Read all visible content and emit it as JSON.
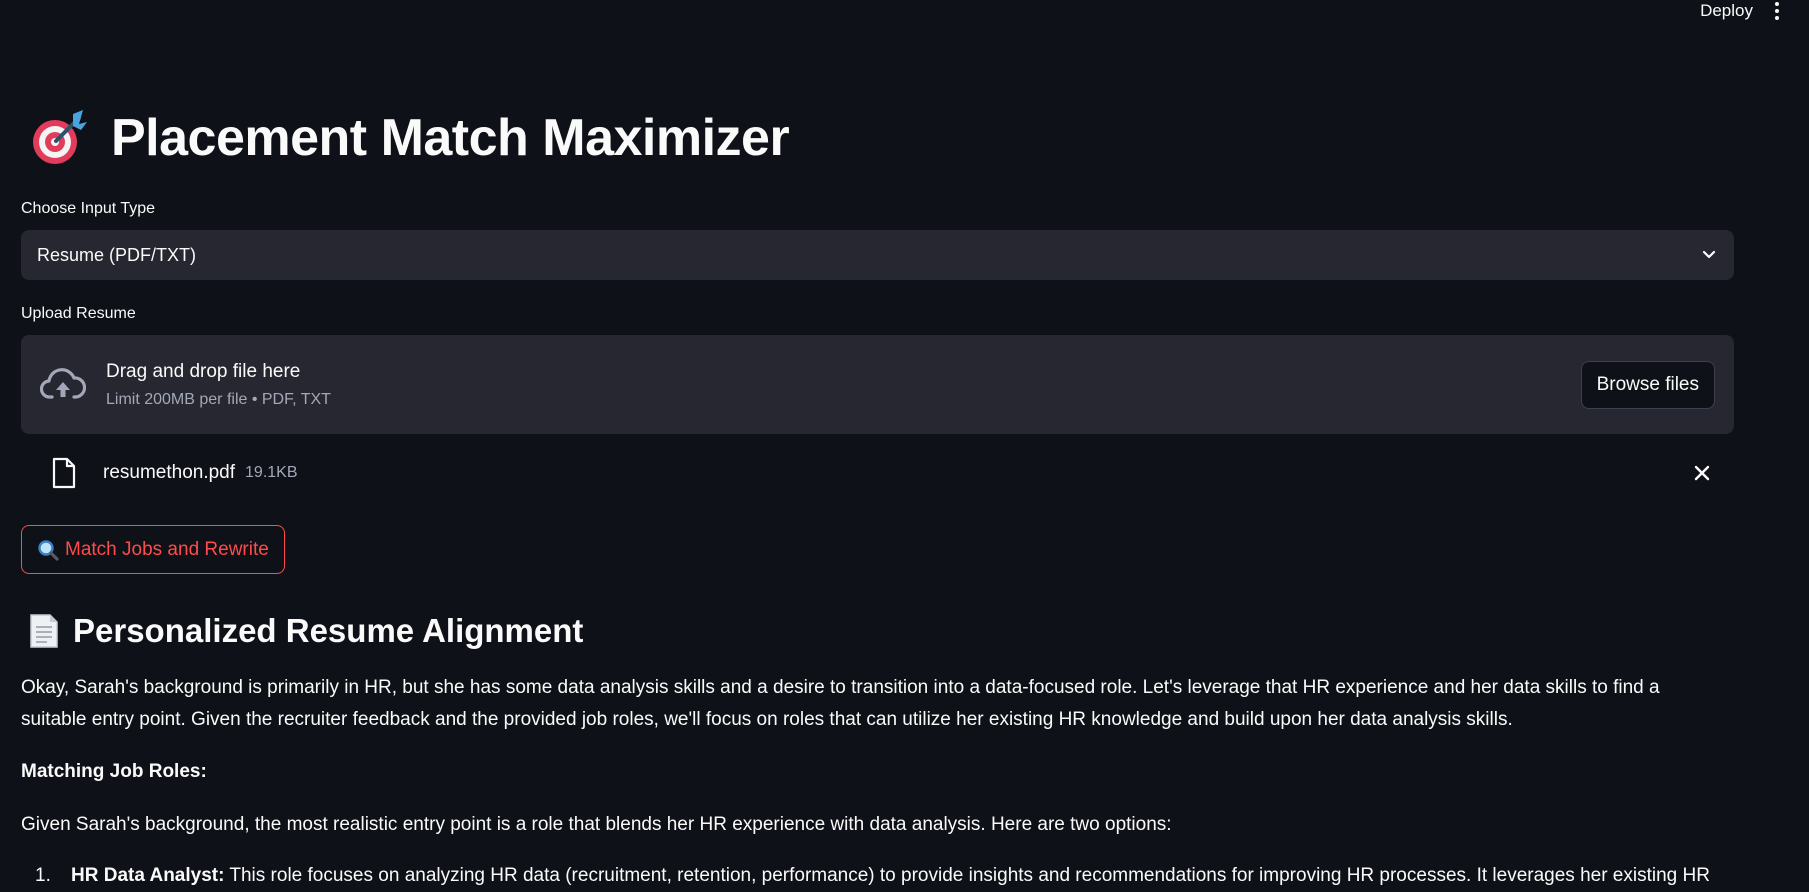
{
  "topbar": {
    "deploy_label": "Deploy"
  },
  "header": {
    "title": "Placement Match Maximizer"
  },
  "input_type": {
    "label": "Choose Input Type",
    "selected": "Resume (PDF/TXT)"
  },
  "upload": {
    "label": "Upload Resume",
    "drop_text": "Drag and drop file here",
    "limit_text": "Limit 200MB per file • PDF, TXT",
    "browse_label": "Browse files"
  },
  "file": {
    "name": "resumethon.pdf",
    "size": "19.1KB"
  },
  "match_button": {
    "label": "Match Jobs and Rewrite"
  },
  "result": {
    "heading": "Personalized Resume Alignment",
    "paragraph1": "Okay, Sarah's background is primarily in HR, but she has some data analysis skills and a desire to transition into a data-focused role. Let's leverage that HR experience and her data skills to find a suitable entry point. Given the recruiter feedback and the provided job roles, we'll focus on roles that can utilize her existing HR knowledge and build upon her data analysis skills.",
    "matching_heading": "Matching Job Roles:",
    "paragraph2": "Given Sarah's background, the most realistic entry point is a role that blends her HR experience with data analysis. Here are two options:",
    "list_item1_number": "1.",
    "list_item1_title": "HR Data Analyst:",
    "list_item1_text": " This role focuses on analyzing HR data (recruitment, retention, performance) to provide insights and recommendations for improving HR processes. It leverages her existing HR"
  },
  "colors": {
    "background": "#0e1117",
    "surface": "#262730",
    "accent": "#ff4b4b",
    "muted_text": "#a3a8b8"
  },
  "icons": [
    "direct-hit-icon",
    "chevron-down-icon",
    "cloud-upload-icon",
    "file-icon",
    "close-icon",
    "magnifier-icon",
    "page-icon",
    "kebab-menu-icon"
  ]
}
